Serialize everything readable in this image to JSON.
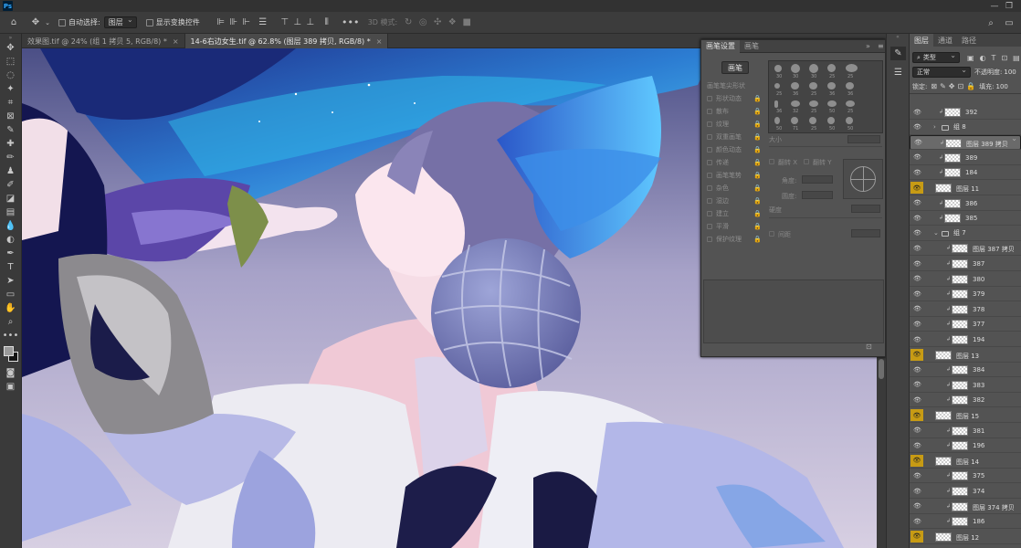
{
  "app": {
    "logo": "Ps",
    "window_controls": [
      "—",
      "❐"
    ]
  },
  "options_bar": {
    "auto_select_label": "自动选择:",
    "auto_select_value": "图层",
    "show_transform_label": "显示变换控件",
    "mode_3d_label": "3D 模式:"
  },
  "tabs": [
    {
      "label": "效果图.tif @ 24% (组 1 拷贝 5, RGB/8) *",
      "close": "×"
    },
    {
      "label": "14-6右边女生.tif @ 62.8% (图层 389 拷贝, RGB/8) *",
      "close": "×"
    }
  ],
  "brush_panel": {
    "tabs": [
      "画笔设置",
      "画笔"
    ],
    "brush_button": "画笔",
    "options": [
      "画笔笔尖形状",
      "形状动态",
      "散布",
      "纹理",
      "双重画笔",
      "颜色动态",
      "传递",
      "画笔笔势",
      "杂色",
      "湿边",
      "建立",
      "平滑",
      "保护纹理"
    ],
    "size_label": "大小",
    "flip_x": "翻转 X",
    "flip_y": "翻转 Y",
    "angle_label": "角度:",
    "roundness_label": "圆度:",
    "hardness_label": "硬度",
    "spacing_label": "间距",
    "tips": [
      {
        "num": "30"
      },
      {
        "num": "30"
      },
      {
        "num": "30"
      },
      {
        "num": "25"
      },
      {
        "num": "25"
      },
      {
        "num": "25"
      },
      {
        "num": "36"
      },
      {
        "num": "25"
      },
      {
        "num": "36"
      },
      {
        "num": "36"
      },
      {
        "num": "36"
      },
      {
        "num": "32"
      },
      {
        "num": "25"
      },
      {
        "num": "50"
      },
      {
        "num": "25"
      },
      {
        "num": "50"
      },
      {
        "num": "71"
      },
      {
        "num": "25"
      },
      {
        "num": "50"
      },
      {
        "num": "50"
      }
    ]
  },
  "layers_panel": {
    "tabs": [
      "图层",
      "通道",
      "路径"
    ],
    "filter_value": "类型",
    "blend_mode": "正常",
    "opacity_label": "不透明度:",
    "opacity_value": "100",
    "lock_label": "锁定:",
    "fill_label": "填充:",
    "fill_value": "100",
    "layers": [
      {
        "name": "392",
        "type": "layer",
        "clip": true,
        "yellow": false,
        "selected": false
      },
      {
        "name": "组 8",
        "type": "group",
        "clip": false,
        "yellow": false,
        "selected": false
      },
      {
        "name": "图层 389 拷贝",
        "type": "layer",
        "clip": true,
        "yellow": false,
        "selected": true
      },
      {
        "name": "389",
        "type": "layer",
        "clip": true,
        "yellow": false,
        "selected": false
      },
      {
        "name": "184",
        "type": "layer",
        "clip": true,
        "yellow": false,
        "selected": false
      },
      {
        "name": "图层 11",
        "type": "layer",
        "clip": false,
        "yellow": true,
        "selected": false
      },
      {
        "name": "386",
        "type": "layer",
        "clip": true,
        "yellow": false,
        "selected": false
      },
      {
        "name": "385",
        "type": "layer",
        "clip": true,
        "yellow": false,
        "selected": false
      },
      {
        "name": "组 7",
        "type": "group",
        "clip": false,
        "yellow": false,
        "selected": false
      },
      {
        "name": "图层 387 拷贝",
        "type": "layer",
        "clip": true,
        "yellow": false,
        "selected": false
      },
      {
        "name": "387",
        "type": "layer",
        "clip": true,
        "yellow": false,
        "selected": false
      },
      {
        "name": "380",
        "type": "layer",
        "clip": true,
        "yellow": false,
        "selected": false
      },
      {
        "name": "379",
        "type": "layer",
        "clip": true,
        "yellow": false,
        "selected": false
      },
      {
        "name": "378",
        "type": "layer",
        "clip": true,
        "yellow": false,
        "selected": false
      },
      {
        "name": "377",
        "type": "layer",
        "clip": true,
        "yellow": false,
        "selected": false
      },
      {
        "name": "194",
        "type": "layer",
        "clip": true,
        "yellow": false,
        "selected": false
      },
      {
        "name": "图层 13",
        "type": "layer",
        "clip": false,
        "yellow": true,
        "selected": false
      },
      {
        "name": "384",
        "type": "layer",
        "clip": true,
        "yellow": false,
        "selected": false
      },
      {
        "name": "383",
        "type": "layer",
        "clip": true,
        "yellow": false,
        "selected": false
      },
      {
        "name": "382",
        "type": "layer",
        "clip": true,
        "yellow": false,
        "selected": false
      },
      {
        "name": "图层 15",
        "type": "layer",
        "clip": false,
        "yellow": true,
        "selected": false
      },
      {
        "name": "381",
        "type": "layer",
        "clip": true,
        "yellow": false,
        "selected": false
      },
      {
        "name": "196",
        "type": "layer",
        "clip": true,
        "yellow": false,
        "selected": false
      },
      {
        "name": "图层 14",
        "type": "layer",
        "clip": false,
        "yellow": true,
        "selected": false
      },
      {
        "name": "375",
        "type": "layer",
        "clip": true,
        "yellow": false,
        "selected": false
      },
      {
        "name": "374",
        "type": "layer",
        "clip": true,
        "yellow": false,
        "selected": false
      },
      {
        "name": "图层 374 拷贝",
        "type": "layer",
        "clip": true,
        "yellow": false,
        "selected": false
      },
      {
        "name": "186",
        "type": "layer",
        "clip": true,
        "yellow": false,
        "selected": false
      },
      {
        "name": "图层 12",
        "type": "layer",
        "clip": false,
        "yellow": true,
        "selected": false
      }
    ]
  },
  "colors": {
    "accent_yellow": "#c79b14",
    "panel": "#535353",
    "dark": "#323232"
  }
}
